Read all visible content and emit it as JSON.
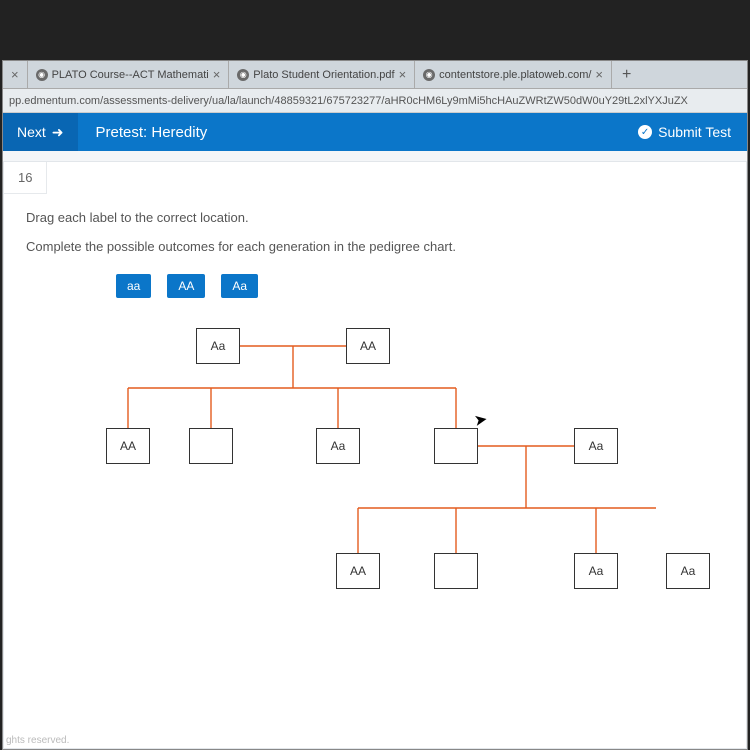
{
  "browser": {
    "tabs": [
      {
        "label": "PLATO Course--ACT Mathemati"
      },
      {
        "label": "Plato Student Orientation.pdf"
      },
      {
        "label": "contentstore.ple.platoweb.com/"
      }
    ],
    "url": "pp.edmentum.com/assessments-delivery/ua/la/launch/48859321/675723277/aHR0cHM6Ly9mMi5hcHAuZWRtZW50dW0uY29tL2xlYXJuZX"
  },
  "header": {
    "next": "Next",
    "title": "Pretest: Heredity",
    "submit": "Submit Test"
  },
  "question": {
    "number": "16",
    "line1": "Drag each label to the correct location.",
    "line2": "Complete the possible outcomes for each generation in the pedigree chart."
  },
  "chips": [
    "aa",
    "AA",
    "Aa"
  ],
  "pedigree": {
    "gen1": [
      "Aa",
      "AA"
    ],
    "gen2": [
      "AA",
      "",
      "Aa",
      "",
      "Aa"
    ],
    "gen3": [
      "AA",
      "",
      "Aa",
      "Aa"
    ]
  },
  "footer": "ghts reserved."
}
